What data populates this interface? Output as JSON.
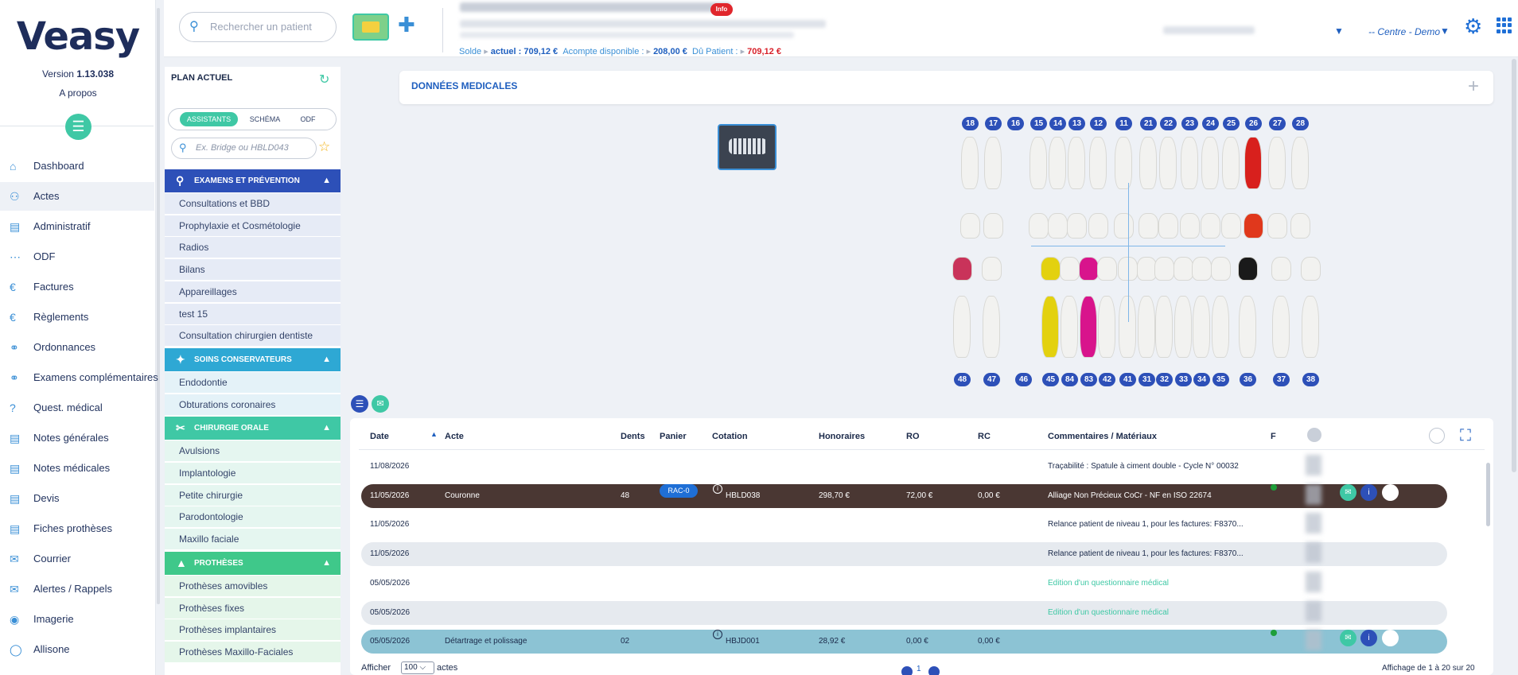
{
  "app": {
    "logo": "Veasy",
    "version_prefix": "Version ",
    "version": "1.13.038",
    "about": "A propos"
  },
  "sidebar": {
    "items": [
      {
        "label": "Dashboard",
        "icon": "home-icon"
      },
      {
        "label": "Actes",
        "icon": "tooth-icon"
      },
      {
        "label": "Administratif",
        "icon": "id-card-icon"
      },
      {
        "label": "ODF",
        "icon": "braces-icon"
      },
      {
        "label": "Factures",
        "icon": "invoice-icon"
      },
      {
        "label": "Règlements",
        "icon": "euro-icon"
      },
      {
        "label": "Ordonnances",
        "icon": "stethoscope-icon"
      },
      {
        "label": "Examens complémentaires",
        "icon": "stethoscope-icon"
      },
      {
        "label": "Quest. médical",
        "icon": "question-icon"
      },
      {
        "label": "Notes générales",
        "icon": "document-icon"
      },
      {
        "label": "Notes médicales",
        "icon": "document-icon"
      },
      {
        "label": "Devis",
        "icon": "document-icon"
      },
      {
        "label": "Fiches prothèses",
        "icon": "file-icon"
      },
      {
        "label": "Courrier",
        "icon": "envelope-icon"
      },
      {
        "label": "Alertes / Rappels",
        "icon": "envelope-icon"
      },
      {
        "label": "Imagerie",
        "icon": "camera-icon"
      },
      {
        "label": "Allisone",
        "icon": "circle-icon"
      }
    ]
  },
  "panel": {
    "title": "PLAN ACTUEL",
    "tabs": [
      "ASSISTANTS",
      "SCHÉMA",
      "ODF"
    ],
    "search_placeholder": "Ex. Bridge ou HBLD043",
    "categories": [
      {
        "label": "EXAMENS ET PRÉVENTION",
        "color": "#2d50b8",
        "items": [
          "Consultations et BBD",
          "Prophylaxie et Cosmétologie",
          "Radios",
          "Bilans",
          "Appareillages",
          "test 15",
          "Consultation chirurgien dentiste"
        ]
      },
      {
        "label": "SOINS CONSERVATEURS",
        "color": "#2ea8d4",
        "items": [
          "Endodontie",
          "Obturations coronaires"
        ]
      },
      {
        "label": "CHIRURGIE ORALE",
        "color": "#3fc8a5",
        "items": [
          "Avulsions",
          "Implantologie",
          "Petite chirurgie",
          "Parodontologie",
          "Maxillo faciale"
        ]
      },
      {
        "label": "PROTHÈSES",
        "color": "#3fc88a",
        "items": [
          "Prothèses amovibles",
          "Prothèses fixes",
          "Prothèses implantaires",
          "Prothèses Maxillo-Faciales"
        ]
      }
    ]
  },
  "topbar": {
    "search_placeholder": "Rechercher un patient",
    "badge": "Info",
    "solde_label": "Solde",
    "actuel_label": "actuel : ",
    "actuel_value": "709,12 €",
    "acompte_label": "Acompte disponible : ",
    "acompte_value": "208,00 €",
    "du_label": "Dû Patient : ",
    "du_value": "709,12 €",
    "centre": "-- Centre - Demo"
  },
  "medical": {
    "title": "DONNÉES MEDICALES"
  },
  "teeth": {
    "upper": [
      "18",
      "17",
      "16",
      "15",
      "14",
      "13",
      "12",
      "11",
      "21",
      "22",
      "23",
      "24",
      "25",
      "26",
      "27",
      "28"
    ],
    "lower": [
      "48",
      "47",
      "46",
      "45",
      "84",
      "83",
      "42",
      "41",
      "31",
      "32",
      "33",
      "34",
      "35",
      "36",
      "37",
      "38"
    ]
  },
  "table": {
    "headers": {
      "date": "Date",
      "acte": "Acte",
      "dents": "Dents",
      "panier": "Panier",
      "cotation": "Cotation",
      "honoraires": "Honoraires",
      "ro": "RO",
      "rc": "RC",
      "commentaires": "Commentaires / Matériaux",
      "f": "F"
    },
    "rows": [
      {
        "date": "11/08/2026",
        "acte": "",
        "dents": "",
        "panier": "",
        "cotation": "",
        "honoraires": "",
        "ro": "",
        "rc": "",
        "comment": "Traçabilité : Spatule à ciment double - Cycle N° 00032",
        "style": "plain"
      },
      {
        "date": "11/05/2026",
        "acte": "Couronne",
        "dents": "48",
        "panier": "RAC-0",
        "cotation": "HBLD038",
        "honoraires": "298,70 €",
        "ro": "72,00 €",
        "rc": "0,00 €",
        "comment": "Alliage Non Précieux CoCr - NF en ISO 22674",
        "style": "dark"
      },
      {
        "date": "11/05/2026",
        "acte": "",
        "dents": "",
        "panier": "",
        "cotation": "",
        "honoraires": "",
        "ro": "",
        "rc": "",
        "comment": "Relance patient de niveau 1, pour les factures: F8370...",
        "style": "plain"
      },
      {
        "date": "11/05/2026",
        "acte": "",
        "dents": "",
        "panier": "",
        "cotation": "",
        "honoraires": "",
        "ro": "",
        "rc": "",
        "comment": "Relance patient de niveau 1, pour les factures: F8370...",
        "style": "grey"
      },
      {
        "date": "05/05/2026",
        "acte": "",
        "dents": "",
        "panier": "",
        "cotation": "",
        "honoraires": "",
        "ro": "",
        "rc": "",
        "comment": "Edition d'un questionnaire médical",
        "style": "plain"
      },
      {
        "date": "05/05/2026",
        "acte": "",
        "dents": "",
        "panier": "",
        "cotation": "",
        "honoraires": "",
        "ro": "",
        "rc": "",
        "comment": "Edition d'un questionnaire médical",
        "style": "grey"
      },
      {
        "date": "05/05/2026",
        "acte": "Détartrage et polissage",
        "dents": "02",
        "panier": "",
        "cotation": "HBJD001",
        "honoraires": "28,92 €",
        "ro": "0,00 €",
        "rc": "0,00 €",
        "comment": "",
        "style": "blue"
      }
    ]
  },
  "footer": {
    "afficher": "Afficher",
    "page_size": "100",
    "actes": "actes",
    "page": "1",
    "affichage": "Affichage de 1 à 20 sur 20"
  }
}
